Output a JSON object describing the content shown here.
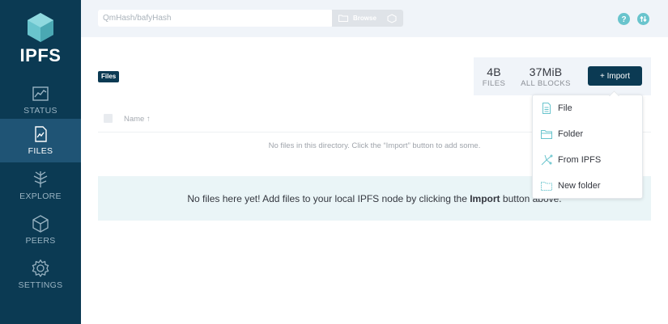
{
  "sidebar": {
    "brand": "IPFS",
    "items": [
      {
        "label": "STATUS",
        "icon": "status-chart-icon"
      },
      {
        "label": "FILES",
        "icon": "files-icon",
        "active": true
      },
      {
        "label": "EXPLORE",
        "icon": "explore-tree-icon"
      },
      {
        "label": "PEERS",
        "icon": "peers-cube-icon"
      },
      {
        "label": "SETTINGS",
        "icon": "settings-gear-icon"
      }
    ]
  },
  "topbar": {
    "search_placeholder": "QmHash/bafyHash",
    "browse_label": "Browse"
  },
  "breadcrumb": {
    "label": "Files"
  },
  "stats": {
    "files_value": "4B",
    "files_label": "FILES",
    "blocks_value": "37MiB",
    "blocks_label": "ALL BLOCKS"
  },
  "import_button": "+ Import",
  "table": {
    "name_header": "Name ↑",
    "empty_message": "No files in this directory. Click the “Import” button to add some."
  },
  "banner": {
    "prefix": "No files here yet! Add files to your local IPFS node by clicking the ",
    "bold": "Import",
    "suffix": " button above."
  },
  "import_menu": {
    "items": [
      "File",
      "Folder",
      "From IPFS",
      "New folder"
    ]
  },
  "colors": {
    "sidebar_bg": "#0b3a53",
    "sidebar_active": "#1f5475",
    "accent_teal": "#69c4cd",
    "banner_bg": "#eaf5f7"
  }
}
